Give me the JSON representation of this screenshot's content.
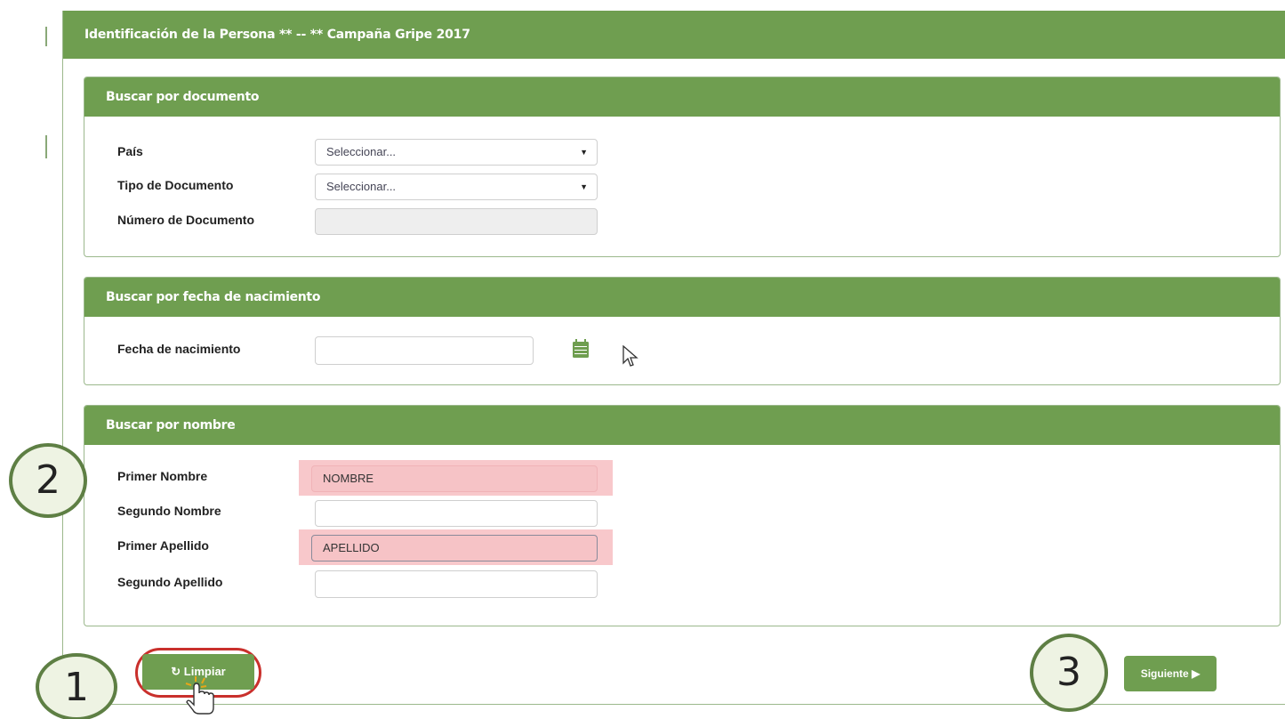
{
  "header": {
    "title": "Identificación de la Persona   ** -- **  Campaña Gripe 2017"
  },
  "document_section": {
    "title": "Buscar por documento",
    "pais_label": "País",
    "pais_value": "Seleccionar...",
    "tipo_label": "Tipo de Documento",
    "tipo_value": "Seleccionar...",
    "numero_label": "Número de Documento",
    "numero_value": ""
  },
  "birth_section": {
    "title": "Buscar por fecha de nacimiento",
    "fecha_label": "Fecha de nacimiento",
    "fecha_value": ""
  },
  "name_section": {
    "title": "Buscar por nombre",
    "primer_nombre_label": "Primer Nombre",
    "primer_nombre_value": "NOMBRE",
    "segundo_nombre_label": "Segundo Nombre",
    "segundo_nombre_value": "",
    "primer_apellido_label": "Primer Apellido",
    "primer_apellido_value": "APELLIDO",
    "segundo_apellido_label": "Segundo Apellido",
    "segundo_apellido_value": ""
  },
  "actions": {
    "clear_label": "Limpiar",
    "clear_icon": "refresh-icon",
    "next_label": "Siguiente",
    "next_icon": "caret-right-icon"
  },
  "annotations": {
    "step1": "1",
    "step2": "2",
    "step3": "3"
  },
  "colors": {
    "accent": "#6f9e50",
    "error": "#f6c3c6",
    "highlight": "#c9302c",
    "badge_border": "#5e7f44"
  }
}
